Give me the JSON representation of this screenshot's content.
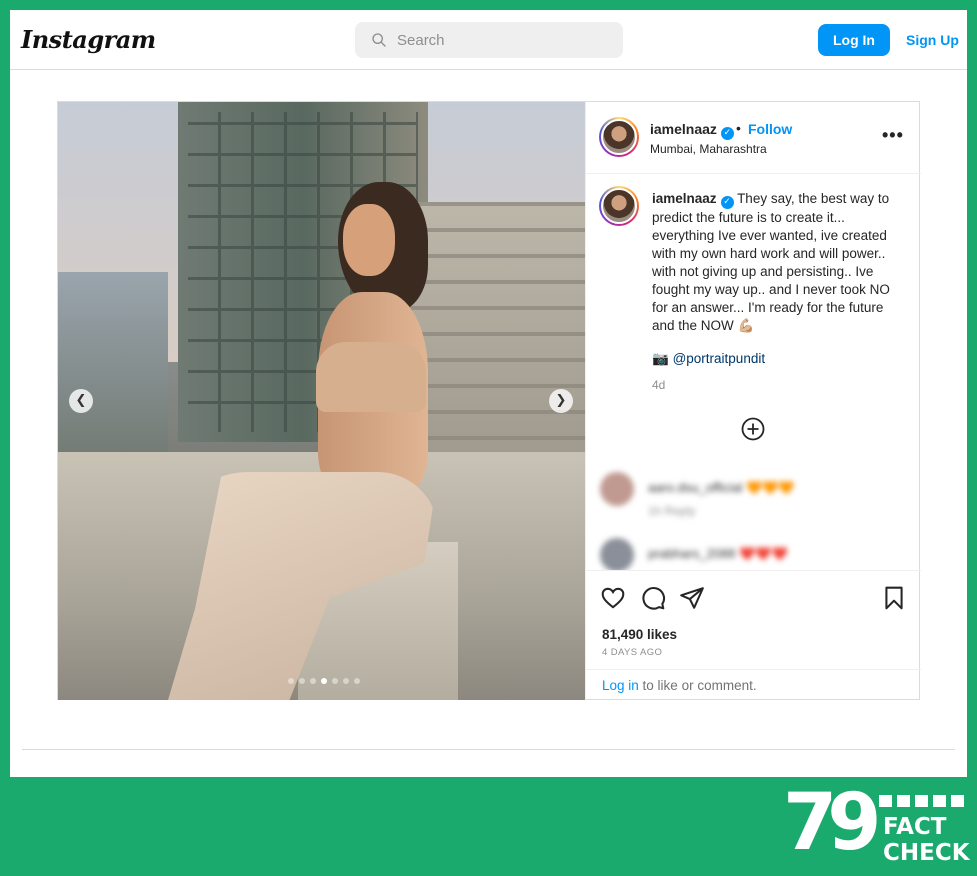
{
  "header": {
    "logo": "Instagram",
    "search_placeholder": "Search",
    "login_label": "Log In",
    "signup_label": "Sign Up"
  },
  "post": {
    "username": "iamelnaaz",
    "verified": true,
    "follow_label": "Follow",
    "separator": "•",
    "location": "Mumbai, Maharashtra",
    "caption": "They say, the best way to predict the future is to create it... everything Ive ever wanted, ive created with my own hard work and will power.. with not giving up and persisting.. Ive fought my way up.. and I never took NO for an answer... I'm ready for the future and the NOW 💪🏼",
    "credit_emoji": "📷",
    "credit_handle": "@portraitpundit",
    "age": "4d",
    "carousel": {
      "total": 7,
      "active": 4
    },
    "likes": "81,490 likes",
    "date": "4 DAYS AGO",
    "login_prompt_link": "Log in",
    "login_prompt_rest": " to like or comment.",
    "comments": [
      {
        "text": "aaro.dsu_official 🧡🧡🧡",
        "sub": "1h    Reply"
      },
      {
        "text": "prabhars_2088 ❤️❤️❤️",
        "sub": ""
      }
    ]
  },
  "branding": {
    "number": "79",
    "line1": "FACT",
    "line2": "CHECK"
  },
  "colors": {
    "frame_green": "#1aaa6e",
    "accent_blue": "#0095f6"
  },
  "icons": [
    "search-icon",
    "chevron-left-icon",
    "chevron-right-icon",
    "more-options-icon",
    "add-circle-icon",
    "heart-icon",
    "comment-icon",
    "share-icon",
    "bookmark-icon",
    "verified-badge-icon"
  ]
}
